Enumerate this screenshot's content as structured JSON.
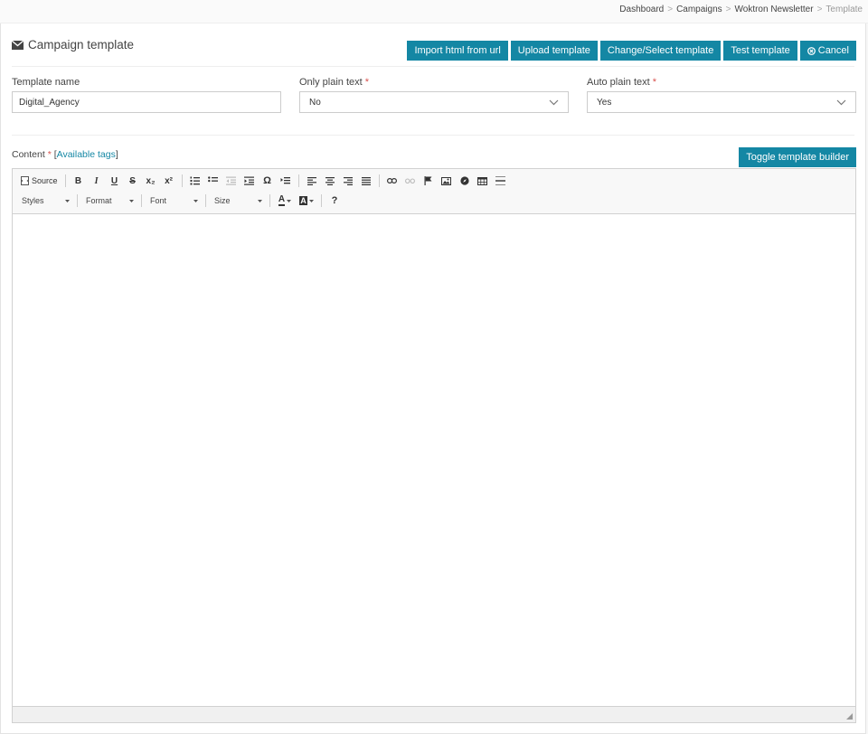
{
  "breadcrumb": [
    {
      "label": "Dashboard"
    },
    {
      "label": "Campaigns"
    },
    {
      "label": "Woktron Newsletter"
    },
    {
      "label": "Template"
    }
  ],
  "breadcrumb_sep": ">",
  "header": {
    "title": "Campaign template",
    "icon": "envelope-icon"
  },
  "actions": {
    "import_url": "Import html from url",
    "upload": "Upload template",
    "change_select": "Change/Select template",
    "test": "Test template",
    "cancel": "Cancel"
  },
  "form": {
    "template_name": {
      "label": "Template name",
      "value": "Digital_Agency"
    },
    "only_plain_text": {
      "label": "Only plain text",
      "value": "No"
    },
    "auto_plain_text": {
      "label": "Auto plain text",
      "value": "Yes"
    },
    "required_mark": "*"
  },
  "content": {
    "label": "Content",
    "required_mark": "*",
    "bracket_open": "[",
    "tags_link": "Available tags",
    "bracket_close": "]",
    "toggle_builder": "Toggle template builder"
  },
  "editor": {
    "source_label": "Source",
    "bold": "B",
    "italic": "I",
    "underline": "U",
    "strike": "S",
    "subscript": "x₂",
    "superscript": "x²",
    "special_char": "Ω",
    "help": "?",
    "styles": "Styles",
    "format": "Format",
    "font": "Font",
    "size": "Size",
    "text_color": "A",
    "bg_color": "A"
  },
  "colors": {
    "accent": "#1487a4",
    "required": "#d9534f"
  }
}
